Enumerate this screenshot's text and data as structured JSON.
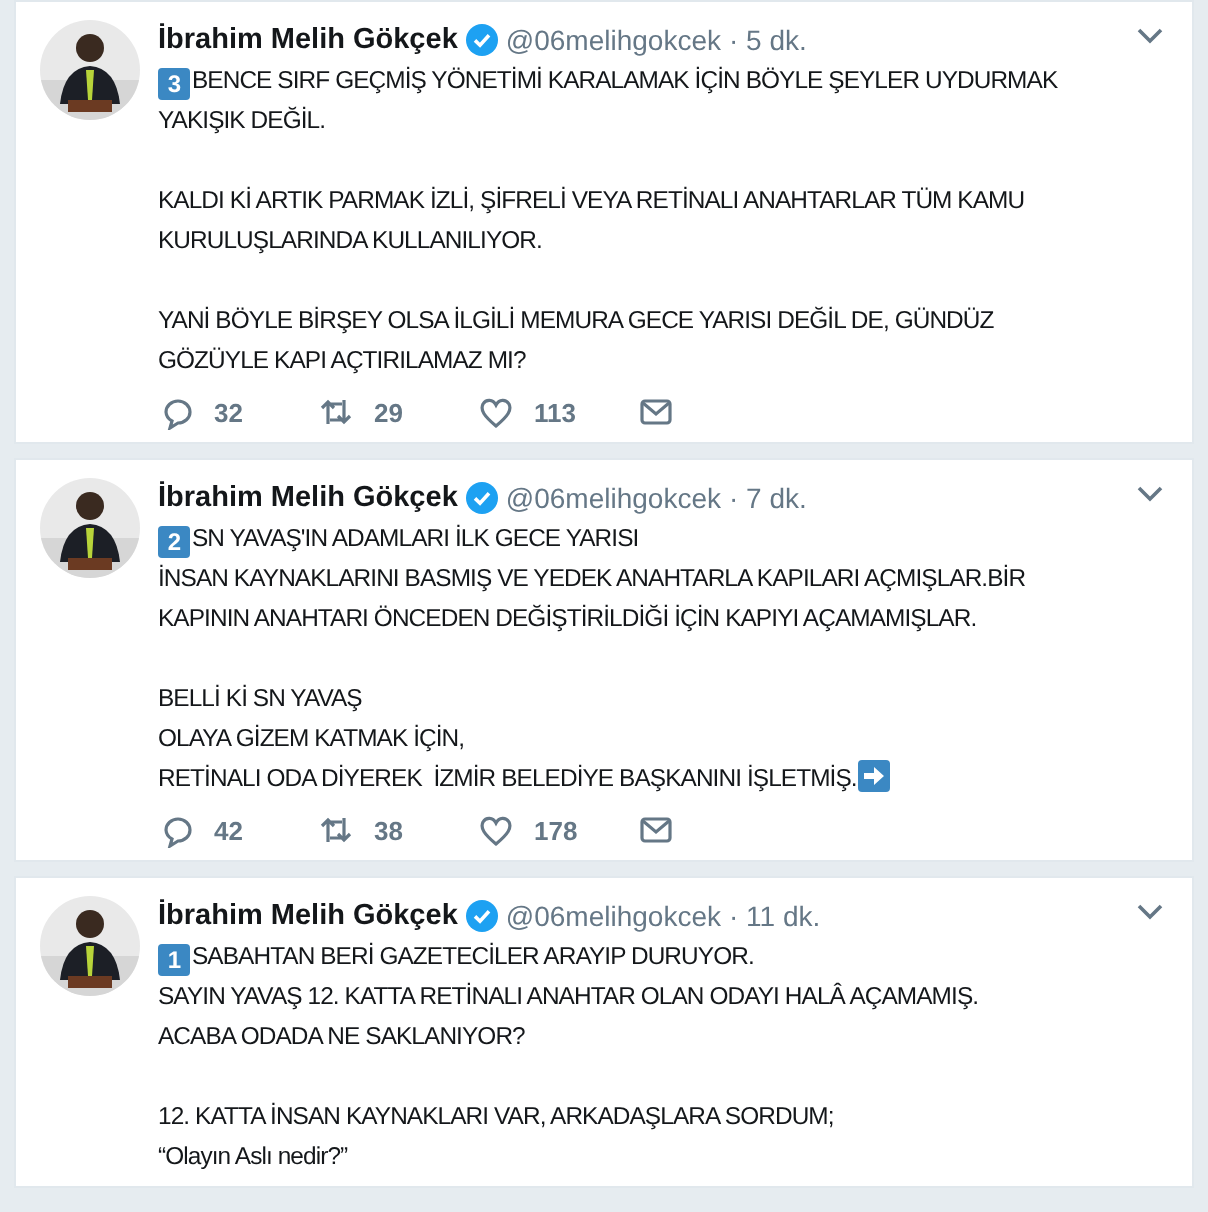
{
  "tweets": [
    {
      "name": "İbrahim Melih Gökçek",
      "verified": true,
      "handle": "@06melihgokcek",
      "time": "· 5 dk.",
      "badge": "3",
      "paragraphs": [
        "BENCE SIRF GEÇMİŞ YÖNETİMİ KARALAMAK İÇİN BÖYLE ŞEYLER UYDURMAK\nYAKIŞIK DEĞİL.",
        "KALDI Kİ ARTIK PARMAK İZLİ, ŞİFRELİ VEYA RETİNALI ANAHTARLAR TÜM KAMU\nKURULUŞLARINDA KULLANILIYOR.",
        "YANİ BÖYLE BİRŞEY OLSA İLGİLİ MEMURA GECE YARISI DEĞİL DE, GÜNDÜZ\nGÖZÜYLE KAPI AÇTIRILAMAZ MI?"
      ],
      "trailing_arrow": false,
      "replies": "32",
      "retweets": "29",
      "likes": "113"
    },
    {
      "name": "İbrahim Melih Gökçek",
      "verified": true,
      "handle": "@06melihgokcek",
      "time": "· 7 dk.",
      "badge": "2",
      "paragraphs": [
        "SN YAVAŞ'IN ADAMLARI İLK GECE YARISI\nİNSAN KAYNAKLARINI BASMIŞ VE YEDEK ANAHTARLA KAPILARI AÇMIŞLAR.BİR\nKAPININ ANAHTARI ÖNCEDEN DEĞİŞTİRİLDİĞİ İÇİN KAPIYI AÇAMAMIŞLAR.",
        "BELLİ Kİ SN YAVAŞ\nOLAYA GİZEM KATMAK İÇİN,\nRETİNALI ODA DİYEREK  İZMİR BELEDİYE BAŞKANINI İŞLETMİŞ."
      ],
      "trailing_arrow": true,
      "replies": "42",
      "retweets": "38",
      "likes": "178"
    },
    {
      "name": "İbrahim Melih Gökçek",
      "verified": true,
      "handle": "@06melihgokcek",
      "time": "· 11 dk.",
      "badge": "1",
      "paragraphs": [
        "SABAHTAN BERİ GAZETECİLER ARAYIP DURUYOR.\nSAYIN YAVAŞ 12. KATTA RETİNALI ANAHTAR OLAN ODAYI HALÂ AÇAMAMIŞ.\nACABA ODADA NE SAKLANIYOR?",
        "12. KATTA İNSAN KAYNAKLARI VAR, ARKADAŞLARA SORDUM;\n“Olayın Aslı nedir?”"
      ],
      "trailing_arrow": false
    }
  ]
}
